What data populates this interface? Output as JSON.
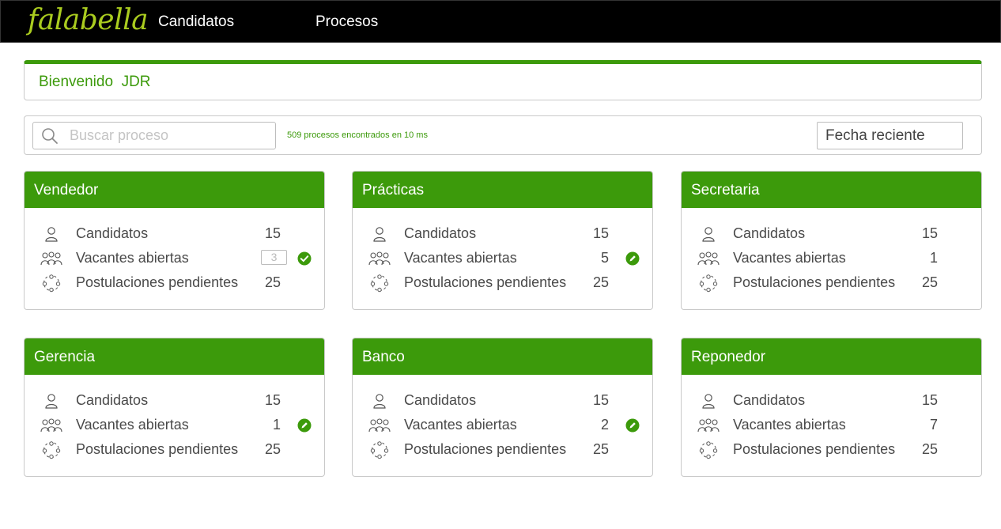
{
  "brand": {
    "logo_text": "falabella",
    "accent": "#3c9a0b",
    "logo_color": "#aacc1f"
  },
  "nav": {
    "items": [
      {
        "label": "Candidatos"
      },
      {
        "label": "Procesos"
      }
    ]
  },
  "welcome": {
    "text": "Bienvenido  JDR"
  },
  "search": {
    "placeholder": "Buscar proceso",
    "value": "",
    "results_text": "509 procesos encontrados en 10 ms",
    "sort_value": "Fecha reciente"
  },
  "row_labels": {
    "candidatos": "Candidatos",
    "vacantes": "Vacantes abiertas",
    "postulaciones": "Postulaciones pendientes"
  },
  "cards": [
    {
      "title": "Vendedor",
      "candidatos": "15",
      "vacantes": "3",
      "postulaciones": "25",
      "vacantes_action": "check-icon"
    },
    {
      "title": "Prácticas",
      "candidatos": "15",
      "vacantes": "5",
      "postulaciones": "25",
      "vacantes_action": "edit-icon"
    },
    {
      "title": "Secretaria",
      "candidatos": "15",
      "vacantes": "1",
      "postulaciones": "25",
      "vacantes_action": ""
    },
    {
      "title": "Gerencia",
      "candidatos": "15",
      "vacantes": "1",
      "postulaciones": "25",
      "vacantes_action": "edit-icon"
    },
    {
      "title": "Banco",
      "candidatos": "15",
      "vacantes": "2",
      "postulaciones": "25",
      "vacantes_action": "edit-icon"
    },
    {
      "title": "Reponedor",
      "candidatos": "15",
      "vacantes": "7",
      "postulaciones": "25",
      "vacantes_action": ""
    }
  ]
}
